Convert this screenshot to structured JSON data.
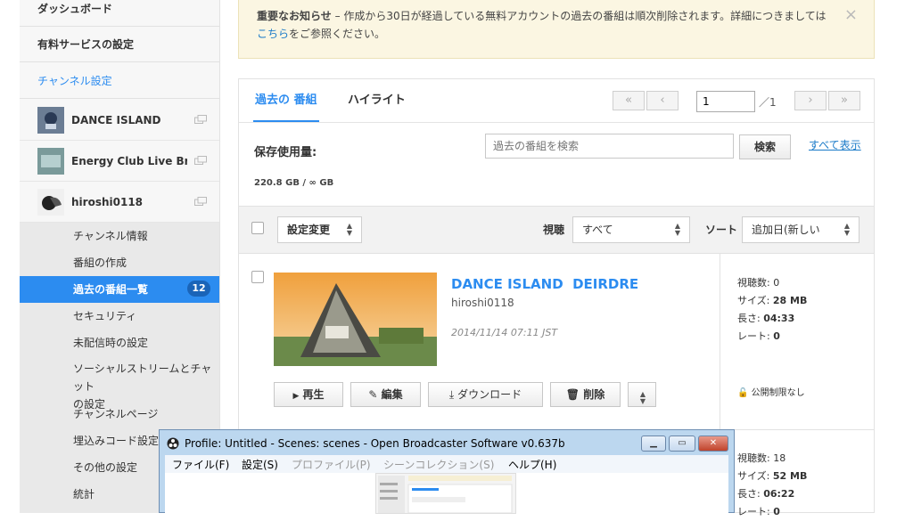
{
  "sidebar": {
    "dashboard": "ダッシュボード",
    "paid_services": "有料サービスの設定",
    "channel_settings": "チャンネル設定",
    "channels": [
      {
        "name": "DANCE ISLAND"
      },
      {
        "name": "Energy Club Live Broa"
      },
      {
        "name": "hiroshi0118"
      }
    ],
    "sub_items": [
      {
        "label": "チャンネル情報"
      },
      {
        "label": "番組の作成"
      },
      {
        "label": "過去の番組一覧",
        "badge": "12"
      },
      {
        "label": "セキュリティ"
      },
      {
        "label": "未配信時の設定"
      },
      {
        "label": "ソーシャルストリームとチャット",
        "label2": "の設定"
      },
      {
        "label": "チャンネルページ"
      },
      {
        "label": "埋込みコード設定"
      },
      {
        "label": "その他の設定"
      },
      {
        "label": "統計"
      }
    ]
  },
  "notice": {
    "bold": "重要なお知らせ",
    "text": " – 作成から30日が経過している無料アカウントの過去の番組は順次削除されます。詳細につきましては",
    "link": "こちら",
    "after": "をご参照ください。",
    "close": "×"
  },
  "tabs": [
    {
      "label": "過去の 番組"
    },
    {
      "label": "ハイライト"
    }
  ],
  "pager": {
    "first": "«",
    "prev": "‹",
    "page": "1",
    "total": "／1",
    "next": "›",
    "last": "»"
  },
  "storage": {
    "label": "保存使用量:",
    "value": "220.8 GB / ∞ GB"
  },
  "search": {
    "placeholder": "過去の番組を検索",
    "button": "検索",
    "show_all": "すべて表示"
  },
  "toolbar": {
    "bulk_change": "設定変更",
    "view_label": "視聴",
    "view_value": "すべて",
    "sort_label": "ソート",
    "sort_value": "追加日(新しい"
  },
  "videos": [
    {
      "title": "DANCE ISLAND  DEIRDRE",
      "owner": "hiroshi0118",
      "date": "2014/11/14 07:11 JST",
      "views": "視聴数: 0",
      "size_label": "サイズ: ",
      "size": "28 MB",
      "length_label": "長さ: ",
      "length": "04:33",
      "rate_label": "レート: ",
      "rate": "0",
      "privacy": "公開制限なし",
      "actions": {
        "play": "再生",
        "edit": "編集",
        "download": "ダウンロード",
        "delete": "削除"
      }
    },
    {
      "views": "視聴数: 18",
      "size_label": "サイズ: ",
      "size": "52 MB",
      "length_label": "長さ: ",
      "length": "06:22",
      "rate_label": "レート: ",
      "rate": "0"
    }
  ],
  "obs": {
    "title": "Profile: Untitled - Scenes: scenes - Open Broadcaster Software v0.637b",
    "menu": [
      "ファイル(F)",
      "設定(S)",
      "プロファイル(P)",
      "シーンコレクション(S)",
      "ヘルプ(H)"
    ]
  },
  "colors": {
    "accent": "#2c8cf0",
    "link": "#1a7ac8",
    "notice_bg": "#fbf6e2"
  }
}
